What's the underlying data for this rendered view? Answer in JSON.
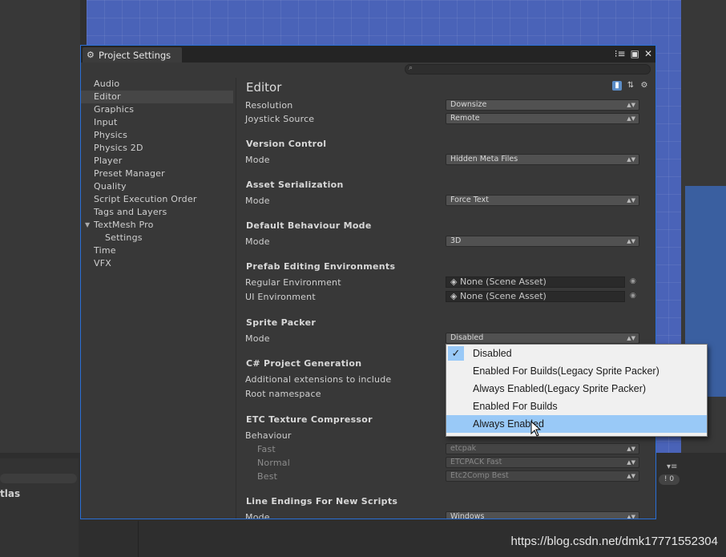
{
  "window": {
    "title": "Project Settings",
    "icons": {
      "tab": "gear-icon",
      "menu": "menu-icon",
      "maximize": "maximize-icon",
      "close": "close-icon",
      "search": "search-icon"
    }
  },
  "sidebar": {
    "items": [
      {
        "label": "Audio"
      },
      {
        "label": "Editor"
      },
      {
        "label": "Graphics"
      },
      {
        "label": "Input"
      },
      {
        "label": "Physics"
      },
      {
        "label": "Physics 2D"
      },
      {
        "label": "Player"
      },
      {
        "label": "Preset Manager"
      },
      {
        "label": "Quality"
      },
      {
        "label": "Script Execution Order"
      },
      {
        "label": "Tags and Layers"
      },
      {
        "label": "TextMesh Pro"
      },
      {
        "label": "Settings"
      },
      {
        "label": "Time"
      },
      {
        "label": "VFX"
      }
    ],
    "selected": "Editor"
  },
  "editor": {
    "title": "Editor",
    "resolution": {
      "label": "Resolution",
      "value": "Downsize"
    },
    "joystick": {
      "label": "Joystick Source",
      "value": "Remote"
    },
    "version_control": {
      "heading": "Version Control",
      "mode_label": "Mode",
      "mode": "Hidden Meta Files"
    },
    "asset_serialization": {
      "heading": "Asset Serialization",
      "mode_label": "Mode",
      "mode": "Force Text"
    },
    "default_behaviour": {
      "heading": "Default Behaviour Mode",
      "mode_label": "Mode",
      "mode": "3D"
    },
    "prefab_envs": {
      "heading": "Prefab Editing Environments",
      "regular_label": "Regular Environment",
      "regular_value": "None (Scene Asset)",
      "ui_label": "UI Environment",
      "ui_value": "None (Scene Asset)"
    },
    "sprite_packer": {
      "heading": "Sprite Packer",
      "mode_label": "Mode",
      "mode": "Disabled"
    },
    "csharp": {
      "heading": "C# Project Generation",
      "ext_label": "Additional extensions to include",
      "ns_label": "Root namespace"
    },
    "etc": {
      "heading": "ETC Texture Compressor",
      "behaviour_label": "Behaviour",
      "fast_label": "Fast",
      "fast_value": "etcpak",
      "normal_label": "Normal",
      "normal_value": "ETCPACK Fast",
      "best_label": "Best",
      "best_value": "Etc2Comp Best"
    },
    "line_endings": {
      "heading": "Line Endings For New Scripts",
      "mode_label": "Mode",
      "mode": "Windows"
    }
  },
  "popup": {
    "options": [
      {
        "label": "Disabled",
        "checked": true
      },
      {
        "label": "Enabled For Builds(Legacy Sprite Packer)"
      },
      {
        "label": "Always Enabled(Legacy Sprite Packer)"
      },
      {
        "label": "Enabled For Builds"
      },
      {
        "label": "Always Enabled",
        "hover": true
      }
    ]
  },
  "background": {
    "atlas_label": "tlas",
    "badge": "0"
  },
  "watermark": "https://blog.csdn.net/dmk17771552304",
  "colors": {
    "accent": "#2a6fd6",
    "popup_highlight": "#99c9f7",
    "scene": "#4a63b8"
  }
}
